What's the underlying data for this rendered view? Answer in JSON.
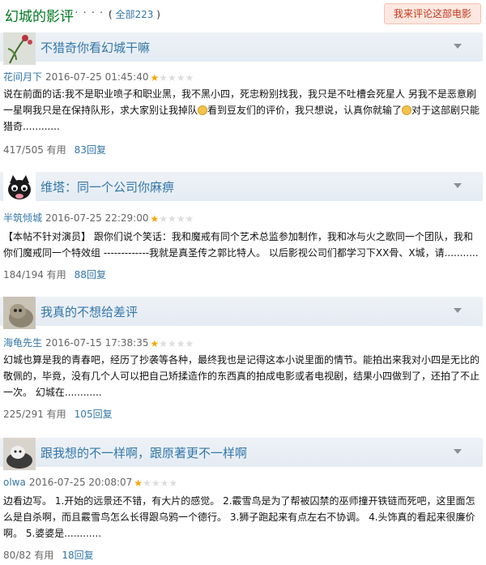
{
  "header": {
    "title": "幻城的影评",
    "dots": "· · · · · ·",
    "count_prefix": "( ",
    "count_link": "全部223",
    "count_suffix": " )",
    "write_review": "我来评论这部电影"
  },
  "reviews": [
    {
      "title": "不猎奇你看幻城干嘛",
      "author": "花间月下",
      "date": "2016-07-25 01:45:40",
      "rating": 1,
      "text_a": "说在前面的话:我不是职业喷子和职业黑，我不黑小四，死忠粉别找我，我只是不吐槽会死星人 另我不是恶意刷一星啊我只是在保持队形，求大家别让我掉队",
      "text_b": "看到豆友们的评价，我只想说，认真你就输了",
      "text_c": "对于这部剧只能猎奇............",
      "useful": "417/505 有用",
      "replies": "83回复"
    },
    {
      "title": "维塔：同一个公司你麻痹",
      "author": "半筑倾城",
      "date": "2016-07-25 22:29:00",
      "rating": 1,
      "text_a": "【本帖不针对演员】 跟你们说个笑话：我和魔戒有同个艺术总监参加制作，我和冰与火之歌同一个团队，我和你们魔戒同一个特效组 -------------我就是真圣传之郭比特人。 以后影视公司们都学习下XX骨、X城，请...........",
      "useful": "184/194 有用",
      "replies": "88回复"
    },
    {
      "title": "我真的不想给差评",
      "author": "海龟先生",
      "date": "2016-07-15 17:38:35",
      "rating": 1,
      "text_a": "幻城也算是我的青春吧，经历了抄袭等各种，最终我也是记得这本小说里面的情节。能拍出来我对小四是无比的敬佩的，毕竟，没有几个人可以把自己矫揉造作的东西真的拍成电影或者电视剧，结果小四做到了，还拍了不止一次。 幻城在............",
      "useful": "225/291 有用",
      "replies": "105回复"
    },
    {
      "title": "跟我想的不一样啊，跟原著更不一样啊",
      "author": "olwa",
      "date": "2016-07-25 20:08:07",
      "rating": 1,
      "text_a": "边看边写。 1.开始的远景还不错，有大片的感觉。 2.霰雪鸟是为了帮被囚禁的巫师撞开铁链而死吧，这里面怎么是自杀啊，而且霰雪鸟怎么长得跟乌鸦一个德行。 3.狮子跑起来有点左右不协调。 4.头饰真的看起来很廉价啊。 5.婆婆是............",
      "useful": "80/82 有用",
      "replies": "18回复"
    }
  ],
  "colors": {
    "accent": "#37a",
    "title_green": "#007722",
    "star": "#f7a600",
    "star_empty": "#ddd"
  },
  "icons": {
    "dropdown": "chevron-down-icon",
    "emoji": "sweat-smile-emoji-icon"
  }
}
